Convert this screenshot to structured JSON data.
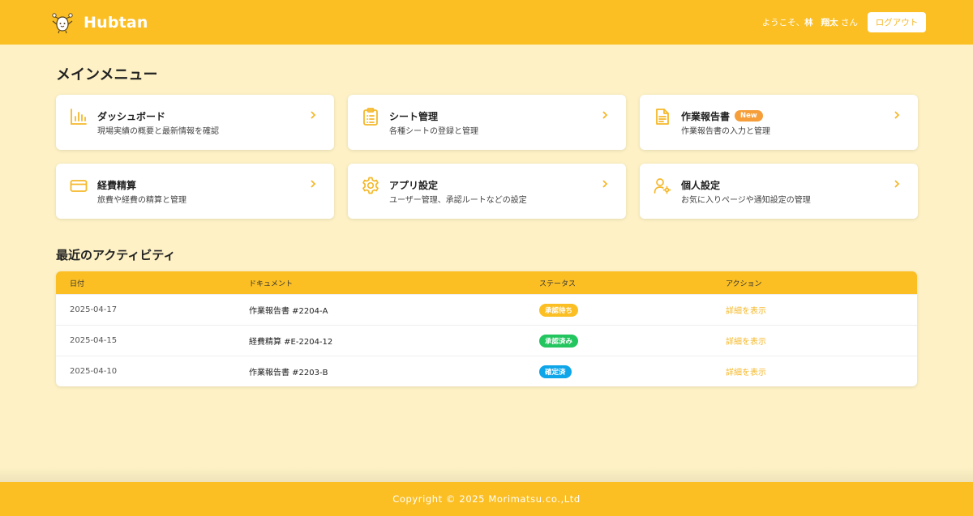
{
  "header": {
    "brand": "Hubtan",
    "welcome_prefix": "ようこそ、",
    "user_last": "林",
    "user_first": "翔太",
    "welcome_suffix": "さん",
    "logout_label": "ログアウト",
    "accent_color": "#fbbf24"
  },
  "menu": {
    "title": "メインメニュー",
    "items": [
      {
        "title": "ダッシュボード",
        "desc": "現場実績の概要と最新情報を確認",
        "icon": "bar-chart-icon"
      },
      {
        "title": "シート管理",
        "desc": "各種シートの登録と管理",
        "icon": "clipboard-list-icon"
      },
      {
        "title": "作業報告書",
        "badge": "New",
        "desc": "作業報告書の入力と管理",
        "icon": "document-icon"
      },
      {
        "title": "経費精算",
        "desc": "旅費や経費の精算と管理",
        "icon": "credit-card-icon"
      },
      {
        "title": "アプリ設定",
        "desc": "ユーザー管理、承認ルートなどの設定",
        "icon": "gear-icon"
      },
      {
        "title": "個人設定",
        "desc": "お気に入りページや通知設定の管理",
        "icon": "user-settings-icon"
      }
    ]
  },
  "activity": {
    "title": "最近のアクティビティ",
    "columns": [
      "日付",
      "ドキュメント",
      "ステータス",
      "アクション"
    ],
    "rows": [
      {
        "date": "2025-04-17",
        "document": "作業報告書 #2204-A",
        "status": "承認待ち",
        "status_color": "#fbbf24",
        "action": "詳細を表示"
      },
      {
        "date": "2025-04-15",
        "document": "経費精算 #E-2204-12",
        "status": "承認済み",
        "status_color": "#22c55e",
        "action": "詳細を表示"
      },
      {
        "date": "2025-04-10",
        "document": "作業報告書 #2203-B",
        "status": "確定済",
        "status_color": "#0ea5e9",
        "action": "詳細を表示"
      }
    ]
  },
  "footer": {
    "copyright": "Copyright © 2025 Morimatsu.co.,Ltd"
  }
}
